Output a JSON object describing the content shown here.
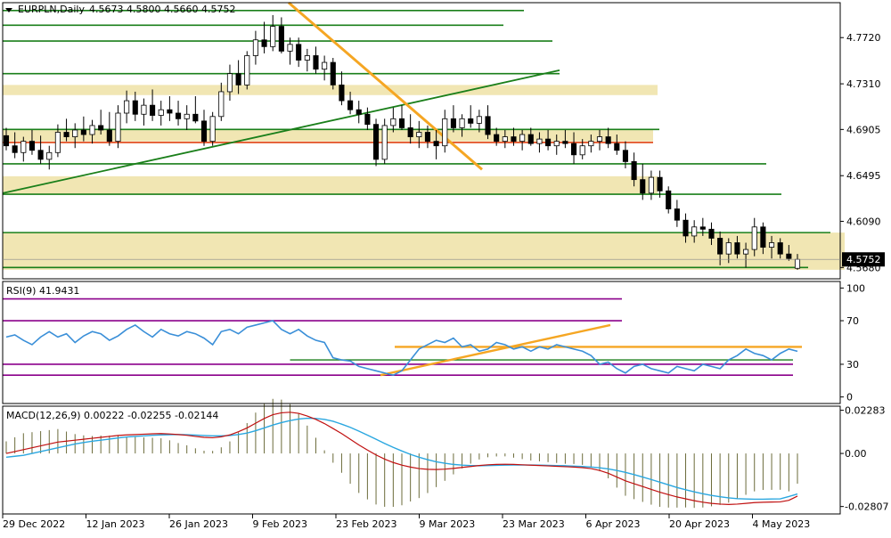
{
  "header": {
    "symbol": "EURPLN,Daily",
    "ohlc": "4.5673 4.5800 4.5660 4.5752"
  },
  "colors": {
    "bull_candle": "#ffffff",
    "bear_candle": "#000000",
    "support_line": "#1a7f1a",
    "trend_line": "#f5a623",
    "resistance_line": "#e04010",
    "zone_fill": "#efe2a6",
    "rsi_line": "#3a8fd8",
    "rsi_level": "#8b008b",
    "macd_line": "#c01010",
    "signal_line": "#2aa7e0",
    "hist_bar": "#6b6b3a",
    "current_price_box": "#000000"
  },
  "chart_data": [
    {
      "type": "candlestick",
      "id": "price",
      "title": "EURPLN,Daily",
      "x_ticks": [
        "29 Dec 2022",
        "12 Jan 2023",
        "26 Jan 2023",
        "9 Feb 2023",
        "23 Feb 2023",
        "9 Mar 2023",
        "23 Mar 2023",
        "6 Apr 2023",
        "20 Apr 2023",
        "4 May 2023"
      ],
      "y_ticks": [
        4.772,
        4.731,
        4.6905,
        4.6495,
        4.609,
        4.568
      ],
      "y_tick_labels": [
        "4.7720",
        "4.7310",
        "4.6905",
        "4.6495",
        "4.6090",
        "4.5680"
      ],
      "ylim": [
        4.558,
        4.803
      ],
      "current_price": "4.5752",
      "ohlc": [
        [
          4.685,
          4.692,
          4.672,
          4.676
        ],
        [
          4.676,
          4.688,
          4.665,
          4.67
        ],
        [
          4.67,
          4.684,
          4.662,
          4.68
        ],
        [
          4.68,
          4.69,
          4.668,
          4.672
        ],
        [
          4.672,
          4.685,
          4.66,
          4.664
        ],
        [
          4.664,
          4.676,
          4.655,
          4.67
        ],
        [
          4.67,
          4.695,
          4.666,
          4.688
        ],
        [
          4.688,
          4.7,
          4.68,
          4.684
        ],
        [
          4.684,
          4.696,
          4.674,
          4.69
        ],
        [
          4.69,
          4.702,
          4.68,
          4.686
        ],
        [
          4.686,
          4.699,
          4.678,
          4.694
        ],
        [
          4.694,
          4.708,
          4.686,
          4.69
        ],
        [
          4.69,
          4.706,
          4.676,
          4.68
        ],
        [
          4.68,
          4.712,
          4.674,
          4.705
        ],
        [
          4.705,
          4.725,
          4.696,
          4.716
        ],
        [
          4.716,
          4.724,
          4.698,
          4.704
        ],
        [
          4.704,
          4.718,
          4.694,
          4.712
        ],
        [
          4.712,
          4.726,
          4.698,
          4.703
        ],
        [
          4.703,
          4.716,
          4.694,
          4.708
        ],
        [
          4.708,
          4.72,
          4.698,
          4.705
        ],
        [
          4.705,
          4.716,
          4.694,
          4.7
        ],
        [
          4.7,
          4.712,
          4.69,
          4.704
        ],
        [
          4.704,
          4.72,
          4.696,
          4.698
        ],
        [
          4.698,
          4.708,
          4.676,
          4.68
        ],
        [
          4.68,
          4.706,
          4.676,
          4.702
        ],
        [
          4.702,
          4.732,
          4.698,
          4.724
        ],
        [
          4.724,
          4.748,
          4.716,
          4.74
        ],
        [
          4.74,
          4.752,
          4.722,
          4.73
        ],
        [
          4.73,
          4.76,
          4.726,
          4.756
        ],
        [
          4.756,
          4.778,
          4.748,
          4.77
        ],
        [
          4.77,
          4.786,
          4.758,
          4.764
        ],
        [
          4.764,
          4.792,
          4.76,
          4.782
        ],
        [
          4.782,
          4.79,
          4.758,
          4.76
        ],
        [
          4.76,
          4.772,
          4.748,
          4.766
        ],
        [
          4.766,
          4.772,
          4.746,
          4.752
        ],
        [
          4.752,
          4.762,
          4.742,
          4.756
        ],
        [
          4.756,
          4.764,
          4.74,
          4.744
        ],
        [
          4.744,
          4.756,
          4.734,
          4.75
        ],
        [
          4.75,
          4.754,
          4.726,
          4.73
        ],
        [
          4.73,
          4.742,
          4.712,
          4.716
        ],
        [
          4.716,
          4.724,
          4.704,
          4.708
        ],
        [
          4.708,
          4.716,
          4.696,
          4.704
        ],
        [
          4.704,
          4.71,
          4.69,
          4.695
        ],
        [
          4.695,
          4.7,
          4.658,
          4.664
        ],
        [
          4.664,
          4.7,
          4.66,
          4.694
        ],
        [
          4.694,
          4.71,
          4.688,
          4.7
        ],
        [
          4.7,
          4.712,
          4.69,
          4.692
        ],
        [
          4.692,
          4.704,
          4.678,
          4.684
        ],
        [
          4.684,
          4.698,
          4.674,
          4.688
        ],
        [
          4.688,
          4.694,
          4.674,
          4.68
        ],
        [
          4.68,
          4.69,
          4.664,
          4.676
        ],
        [
          4.676,
          4.708,
          4.67,
          4.7
        ],
        [
          4.7,
          4.712,
          4.688,
          4.692
        ],
        [
          4.692,
          4.704,
          4.684,
          4.7
        ],
        [
          4.7,
          4.712,
          4.692,
          4.696
        ],
        [
          4.696,
          4.708,
          4.688,
          4.702
        ],
        [
          4.702,
          4.712,
          4.682,
          4.686
        ],
        [
          4.686,
          4.692,
          4.676,
          4.68
        ],
        [
          4.68,
          4.69,
          4.674,
          4.684
        ],
        [
          4.684,
          4.692,
          4.676,
          4.68
        ],
        [
          4.68,
          4.69,
          4.672,
          4.686
        ],
        [
          4.686,
          4.692,
          4.676,
          4.678
        ],
        [
          4.678,
          4.688,
          4.67,
          4.682
        ],
        [
          4.682,
          4.69,
          4.672,
          4.676
        ],
        [
          4.676,
          4.686,
          4.668,
          4.68
        ],
        [
          4.68,
          4.69,
          4.674,
          4.678
        ],
        [
          4.678,
          4.688,
          4.66,
          4.668
        ],
        [
          4.668,
          4.682,
          4.664,
          4.676
        ],
        [
          4.676,
          4.686,
          4.67,
          4.68
        ],
        [
          4.68,
          4.69,
          4.672,
          4.684
        ],
        [
          4.684,
          4.692,
          4.674,
          4.678
        ],
        [
          4.678,
          4.686,
          4.668,
          4.672
        ],
        [
          4.672,
          4.68,
          4.656,
          4.662
        ],
        [
          4.662,
          4.67,
          4.64,
          4.646
        ],
        [
          4.646,
          4.66,
          4.628,
          4.634
        ],
        [
          4.634,
          4.654,
          4.628,
          4.648
        ],
        [
          4.648,
          4.654,
          4.63,
          4.636
        ],
        [
          4.636,
          4.64,
          4.616,
          4.62
        ],
        [
          4.62,
          4.628,
          4.604,
          4.61
        ],
        [
          4.61,
          4.616,
          4.59,
          4.596
        ],
        [
          4.596,
          4.61,
          4.59,
          4.604
        ],
        [
          4.604,
          4.612,
          4.596,
          4.602
        ],
        [
          4.602,
          4.608,
          4.588,
          4.594
        ],
        [
          4.594,
          4.6,
          4.57,
          4.58
        ],
        [
          4.58,
          4.594,
          4.572,
          4.59
        ],
        [
          4.59,
          4.596,
          4.576,
          4.58
        ],
        [
          4.58,
          4.59,
          4.568,
          4.584
        ],
        [
          4.584,
          4.612,
          4.578,
          4.604
        ],
        [
          4.604,
          4.608,
          4.58,
          4.586
        ],
        [
          4.586,
          4.596,
          4.576,
          4.59
        ],
        [
          4.59,
          4.594,
          4.576,
          4.58
        ],
        [
          4.58,
          4.588,
          4.574,
          4.576
        ],
        [
          4.5673,
          4.58,
          4.566,
          4.5752
        ]
      ]
    },
    {
      "type": "line",
      "id": "rsi",
      "title": "RSI(9) 41.9431",
      "y_ticks": [
        100,
        70,
        30,
        0
      ],
      "y_tick_labels": [
        "100",
        "70",
        "30",
        "0"
      ],
      "ylim": [
        -6,
        106
      ],
      "levels": [
        90,
        70,
        30,
        20
      ],
      "values": [
        55,
        57,
        52,
        48,
        55,
        60,
        55,
        58,
        50,
        56,
        60,
        58,
        52,
        56,
        62,
        66,
        60,
        55,
        62,
        58,
        56,
        60,
        58,
        54,
        48,
        60,
        62,
        58,
        64,
        66,
        68,
        70,
        62,
        58,
        62,
        56,
        52,
        50,
        36,
        34,
        33,
        28,
        26,
        24,
        22,
        20,
        24,
        34,
        44,
        48,
        52,
        50,
        54,
        46,
        48,
        42,
        44,
        50,
        48,
        44,
        46,
        42,
        46,
        44,
        48,
        46,
        44,
        42,
        38,
        30,
        32,
        26,
        22,
        28,
        30,
        26,
        24,
        22,
        28,
        26,
        24,
        30,
        28,
        26,
        34,
        38,
        44,
        40,
        38,
        34,
        40,
        44,
        41.9431
      ]
    },
    {
      "type": "line",
      "id": "macd",
      "title": "MACD(12,26,9) 0.00222 -0.02255 -0.02144",
      "y_ticks": [
        0.02283,
        0.0,
        -0.02807
      ],
      "y_tick_labels": [
        "0.02283",
        "0.00",
        "-0.02807"
      ],
      "ylim": [
        -0.032,
        0.025
      ],
      "series": [
        {
          "name": "MACD",
          "values": [
            0,
            0.001,
            0.002,
            0.003,
            0.004,
            0.005,
            0.006,
            0.0065,
            0.007,
            0.0075,
            0.008,
            0.0085,
            0.009,
            0.0095,
            0.0098,
            0.01,
            0.0102,
            0.0104,
            0.0105,
            0.0103,
            0.01,
            0.0096,
            0.009,
            0.0085,
            0.0083,
            0.0088,
            0.0098,
            0.0115,
            0.0135,
            0.016,
            0.0185,
            0.0205,
            0.0215,
            0.0218,
            0.0212,
            0.0198,
            0.018,
            0.0158,
            0.0132,
            0.0105,
            0.0075,
            0.0045,
            0.0018,
            -0.0008,
            -0.003,
            -0.0048,
            -0.0062,
            -0.0072,
            -0.008,
            -0.0084,
            -0.0085,
            -0.0083,
            -0.0079,
            -0.0074,
            -0.0069,
            -0.0064,
            -0.006,
            -0.0058,
            -0.0057,
            -0.0058,
            -0.006,
            -0.0062,
            -0.0064,
            -0.0066,
            -0.0068,
            -0.007,
            -0.0072,
            -0.0075,
            -0.008,
            -0.009,
            -0.0105,
            -0.0125,
            -0.0145,
            -0.016,
            -0.0175,
            -0.019,
            -0.0205,
            -0.0218,
            -0.023,
            -0.024,
            -0.025,
            -0.0258,
            -0.0264,
            -0.0268,
            -0.027,
            -0.0268,
            -0.0264,
            -0.026,
            -0.0258,
            -0.0257,
            -0.0256,
            -0.0248,
            -0.02255
          ]
        },
        {
          "name": "Signal",
          "values": [
            -0.002,
            -0.0015,
            -0.001,
            0,
            0.001,
            0.002,
            0.003,
            0.004,
            0.005,
            0.0058,
            0.0065,
            0.007,
            0.0076,
            0.0082,
            0.0087,
            0.009,
            0.0093,
            0.0096,
            0.0098,
            0.0099,
            0.01,
            0.0099,
            0.0097,
            0.0095,
            0.0093,
            0.0093,
            0.0095,
            0.01,
            0.0108,
            0.012,
            0.0135,
            0.015,
            0.0163,
            0.0174,
            0.0182,
            0.0186,
            0.0185,
            0.018,
            0.017,
            0.0155,
            0.0138,
            0.0118,
            0.0097,
            0.0075,
            0.0053,
            0.0032,
            0.0013,
            -0.0005,
            -0.002,
            -0.0033,
            -0.0044,
            -0.0052,
            -0.0058,
            -0.0062,
            -0.0064,
            -0.0065,
            -0.0064,
            -0.0063,
            -0.0062,
            -0.0061,
            -0.0061,
            -0.0061,
            -0.0062,
            -0.0063,
            -0.0064,
            -0.0065,
            -0.0067,
            -0.0069,
            -0.0072,
            -0.0076,
            -0.0082,
            -0.009,
            -0.01,
            -0.0112,
            -0.0125,
            -0.0138,
            -0.0152,
            -0.0166,
            -0.018,
            -0.0192,
            -0.0203,
            -0.0213,
            -0.0222,
            -0.0229,
            -0.0235,
            -0.0239,
            -0.0241,
            -0.0242,
            -0.0242,
            -0.0241,
            -0.024,
            -0.0228,
            -0.02144
          ]
        }
      ]
    }
  ],
  "annotations": {
    "horizontal_lines": [
      4.796,
      4.783,
      4.769,
      4.74,
      4.6905,
      4.66,
      4.633,
      4.599,
      4.568
    ],
    "resistance_line": 4.679,
    "zones": [
      [
        4.721,
        4.73
      ],
      [
        4.68,
        4.6905
      ],
      [
        4.633,
        4.649
      ],
      [
        4.566,
        4.599
      ]
    ],
    "trend_up": [
      [
        4.634,
        0
      ],
      [
        4.743,
        88
      ]
    ],
    "trend_down": [
      [
        4.803,
        44
      ],
      [
        4.655,
        73
      ]
    ],
    "rsi_trend": [
      [
        20,
        57
      ],
      [
        66,
        92
      ]
    ],
    "rsi_hline": [
      46,
      107
    ]
  }
}
